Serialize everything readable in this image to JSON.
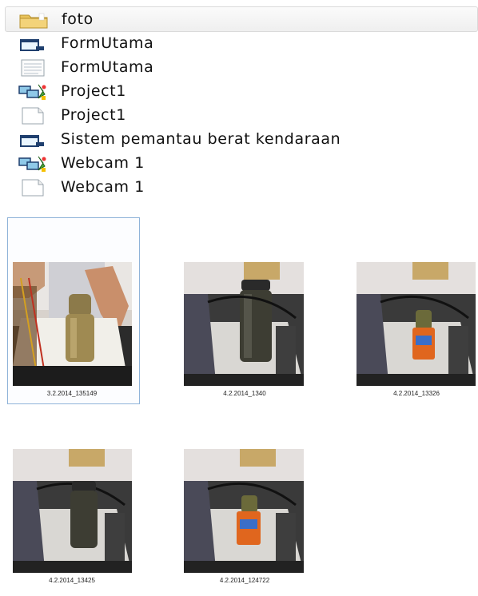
{
  "files": [
    {
      "name": "foto",
      "icon": "folder-icon",
      "selected": true
    },
    {
      "name": "FormUtama",
      "icon": "vb-form-icon"
    },
    {
      "name": "FormUtama",
      "icon": "text-file-icon"
    },
    {
      "name": "Project1",
      "icon": "vb-project-icon"
    },
    {
      "name": "Project1",
      "icon": "blank-file-icon"
    },
    {
      "name": "Sistem pemantau berat kendaraan",
      "icon": "vb-form-icon"
    },
    {
      "name": "Webcam 1",
      "icon": "vb-project-icon"
    },
    {
      "name": "Webcam 1",
      "icon": "blank-file-icon"
    }
  ],
  "thumbnails": [
    {
      "caption": "3.2.2014_135149",
      "selected": true
    },
    {
      "caption": "4.2.2014_1340"
    },
    {
      "caption": "4.2.2014_13326"
    },
    {
      "caption": "4.2.2014_13425"
    },
    {
      "caption": "4.2.2014_124722"
    }
  ]
}
